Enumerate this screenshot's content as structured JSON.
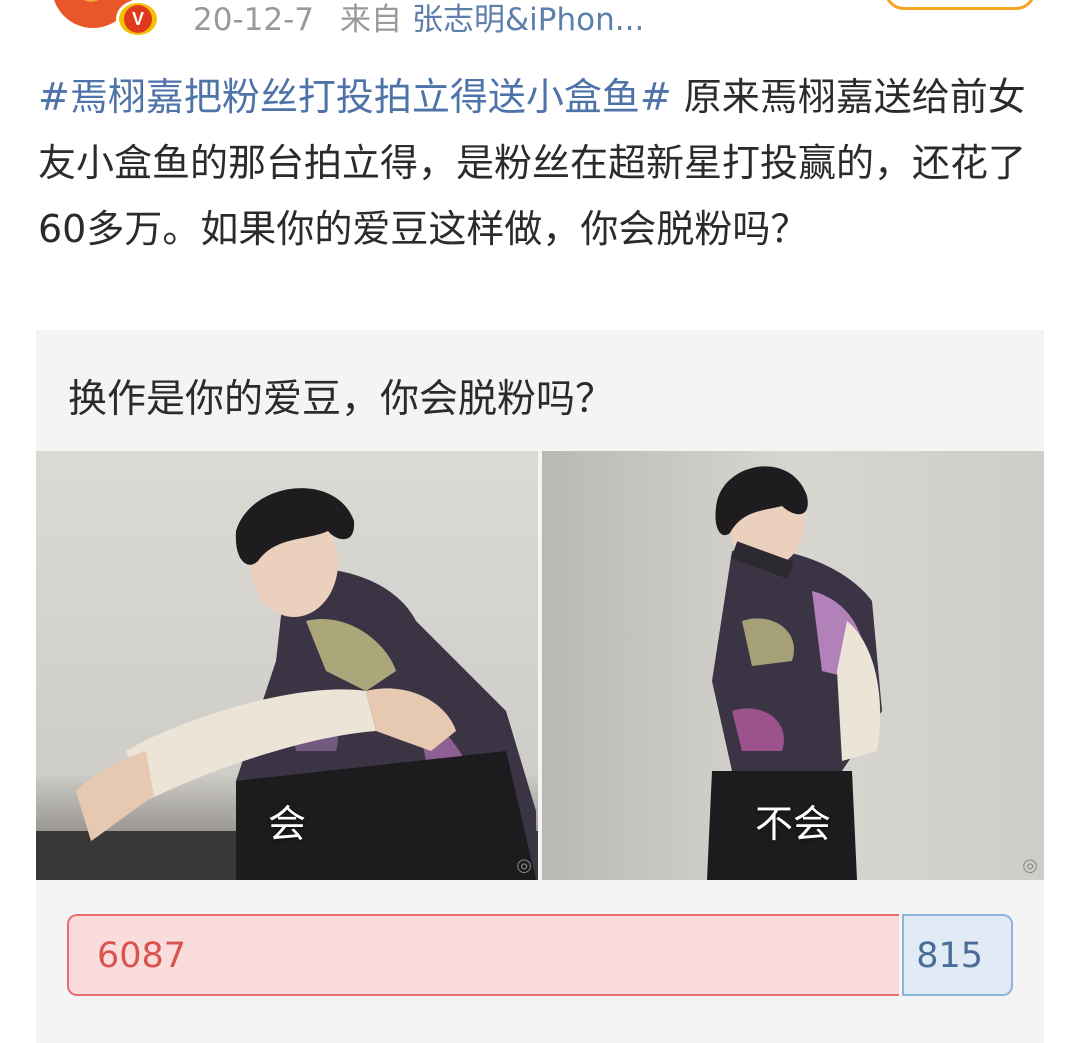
{
  "header": {
    "date": "20-12-7",
    "source_prefix": "来自",
    "source_device": "张志明&iPhon...",
    "verified_badge": "V"
  },
  "post": {
    "hashtag": "#焉栩嘉把粉丝打投拍立得送小盒鱼#",
    "body": " 原来焉栩嘉送给前女友小盒鱼的那台拍立得，是粉丝在超新星打投赢的，还花了60多万。如果你的爱豆这样做，你会脱粉吗？"
  },
  "poll": {
    "question": "换作是你的爱豆，你会脱粉吗？",
    "options": [
      {
        "label": "会",
        "votes": "6087",
        "share": 0.882,
        "color": "#e86f6f"
      },
      {
        "label": "不会",
        "votes": "815",
        "share": 0.118,
        "color": "#8fb4db"
      }
    ],
    "watermark_icon": "weibo-logo-icon"
  },
  "colors": {
    "hashtag": "#4d73a8",
    "device_link": "#5c7fab",
    "follow_button_border": "#f5a623"
  }
}
